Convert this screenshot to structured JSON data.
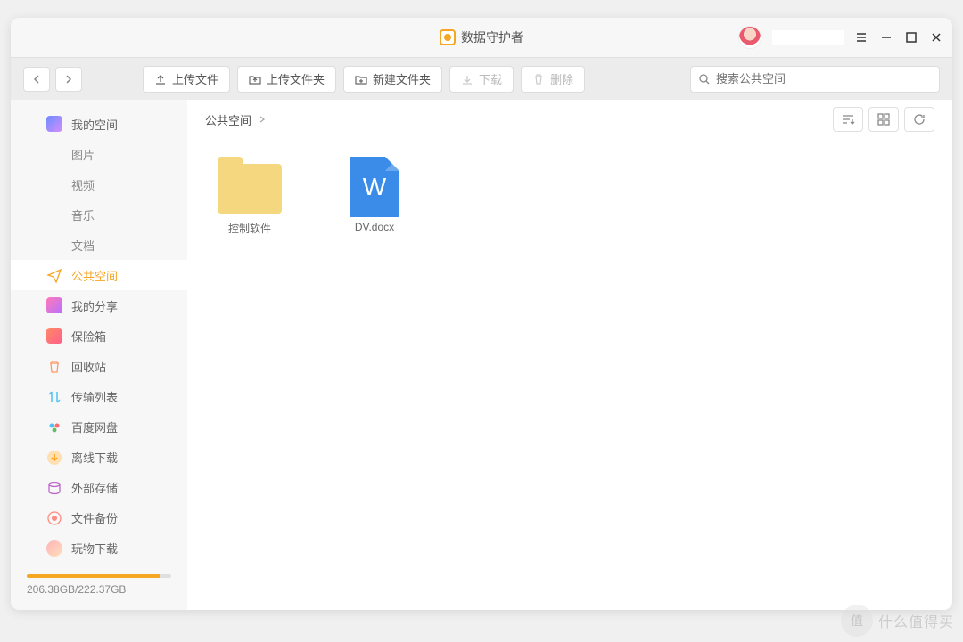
{
  "app": {
    "title": "数据守护者"
  },
  "toolbar": {
    "upload_file": "上传文件",
    "upload_folder": "上传文件夹",
    "new_folder": "新建文件夹",
    "download": "下载",
    "delete": "删除"
  },
  "search": {
    "placeholder": "搜索公共空间"
  },
  "sidebar": {
    "items": [
      {
        "label": "我的空间"
      },
      {
        "label": "图片"
      },
      {
        "label": "视频"
      },
      {
        "label": "音乐"
      },
      {
        "label": "文档"
      },
      {
        "label": "公共空间"
      },
      {
        "label": "我的分享"
      },
      {
        "label": "保险箱"
      },
      {
        "label": "回收站"
      },
      {
        "label": "传输列表"
      },
      {
        "label": "百度网盘"
      },
      {
        "label": "离线下载"
      },
      {
        "label": "外部存储"
      },
      {
        "label": "文件备份"
      },
      {
        "label": "玩物下载"
      }
    ]
  },
  "storage": {
    "text": "206.38GB/222.37GB",
    "percent": 92.8
  },
  "breadcrumb": {
    "current": "公共空间"
  },
  "files": [
    {
      "name": "控制软件",
      "type": "folder"
    },
    {
      "name": "DV.docx",
      "type": "docx"
    }
  ],
  "watermark": {
    "badge": "值",
    "text": "什么值得买"
  }
}
